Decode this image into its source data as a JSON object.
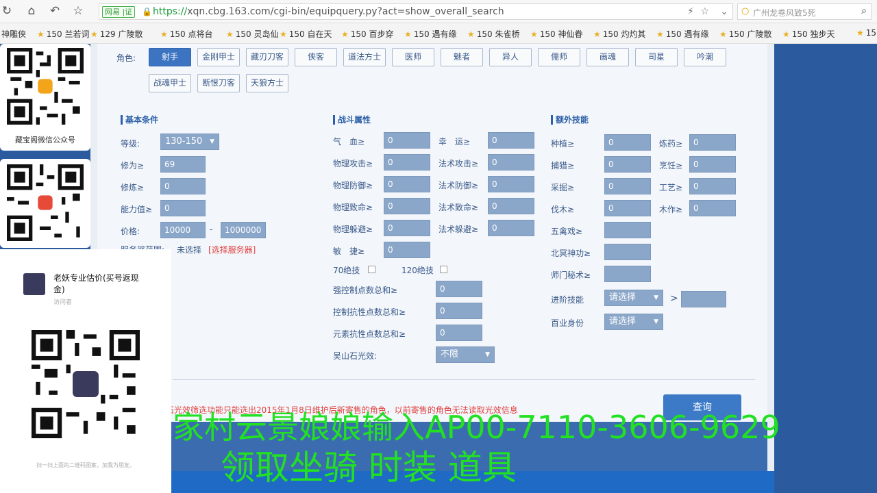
{
  "browser": {
    "url_prefix": "https://",
    "url_domain": "xqn.cbg.163.com",
    "url_path": "/cgi-bin/equipquery.py?act=show_overall_search",
    "badge": "网易 |证",
    "search_text": "广州龙卷风致5死"
  },
  "bookmarks": [
    "神雕侠",
    "150 兰若词",
    "129 广陵散",
    "150 点将台",
    "150 灵岛仙",
    "150 自在天",
    "150 百步穿",
    "150 遇有缘",
    "150 朱雀桥",
    "150 神仙眷",
    "150 灼灼其",
    "150 遇有缘",
    "150 广陵散",
    "150 独步天",
    "15"
  ],
  "sidebar": {
    "qr1_caption": "藏宝阁微信公众号"
  },
  "roles": {
    "label": "角色:",
    "items": [
      "射手",
      "金刚甲士",
      "藏刃刀客",
      "侠客",
      "道法方士",
      "医师",
      "魅者",
      "异人",
      "儒师",
      "画魂",
      "司星",
      "吟潮",
      "战魂甲士",
      "断恨刀客",
      "天狼方士"
    ]
  },
  "basic": {
    "title": "基本条件",
    "level_label": "等级:",
    "level_value": "130-150",
    "xiuwei_label": "修为≥",
    "xiuwei_value": "69",
    "xiulian_label": "修炼≥",
    "xiulian_value": "0",
    "ability_label": "能力值≥",
    "ability_value": "0",
    "price_label": "价格:",
    "price_min": "10000",
    "price_dash": "-",
    "price_max": "1000000",
    "server_label": "服务器范围:",
    "server_value": "未选择",
    "server_link": "[选择服务器]"
  },
  "battle": {
    "title": "战斗属性",
    "left": [
      {
        "label": "气　血≥",
        "value": "0"
      },
      {
        "label": "物理攻击≥",
        "value": "0"
      },
      {
        "label": "物理防御≥",
        "value": "0"
      },
      {
        "label": "物理致命≥",
        "value": "0"
      },
      {
        "label": "物理躲避≥",
        "value": "0"
      },
      {
        "label": "敏　捷≥",
        "value": "0"
      }
    ],
    "right": [
      {
        "label": "幸　运≥",
        "value": "0"
      },
      {
        "label": "法术攻击≥",
        "value": "0"
      },
      {
        "label": "法术防御≥",
        "value": "0"
      },
      {
        "label": "法术致命≥",
        "value": "0"
      },
      {
        "label": "法术躲避≥",
        "value": "0"
      }
    ],
    "skill70": "70绝技",
    "skill120": "120绝技",
    "extra": [
      {
        "label": "强控制点数总和≥",
        "value": "0"
      },
      {
        "label": "控制抗性点数总和≥",
        "value": "0"
      },
      {
        "label": "元素抗性点数总和≥",
        "value": "0"
      }
    ],
    "wushan_label": "吴山石光效:",
    "wushan_value": "不限"
  },
  "extraskill": {
    "title": "额外技能",
    "left": [
      {
        "label": "种植≥",
        "value": "0"
      },
      {
        "label": "捕猎≥",
        "value": "0"
      },
      {
        "label": "采掘≥",
        "value": "0"
      },
      {
        "label": "伐木≥",
        "value": "0"
      }
    ],
    "right": [
      {
        "label": "炼药≥",
        "value": "0"
      },
      {
        "label": "烹饪≥",
        "value": "0"
      },
      {
        "label": "工艺≥",
        "value": "0"
      },
      {
        "label": "木作≥",
        "value": "0"
      }
    ],
    "more": [
      {
        "label": "五禽戏≥",
        "value": ""
      },
      {
        "label": "北冥神功≥",
        "value": ""
      },
      {
        "label": "师门秘术≥",
        "value": ""
      }
    ],
    "advanced_label": "进阶技能",
    "advanced_value": "请选择",
    "gt": ">",
    "industry_label": "百业身份",
    "industry_value": "请选择"
  },
  "warning": "石光效筛选功能只能选出2015年1月8日维护后新寄售的角色，以前寄售的角色无法读取光效信息",
  "query_button": "查询",
  "popup": {
    "title": "老妖专业估价(买号返现金)",
    "sub": "访问者",
    "foot": "扫一扫上面的二维码图案，加我为朋友。"
  },
  "overlay": {
    "line1": "家村云景娘娘输入AP00-7110-3606-9629",
    "line2": "领取坐骑 时装 道具"
  }
}
